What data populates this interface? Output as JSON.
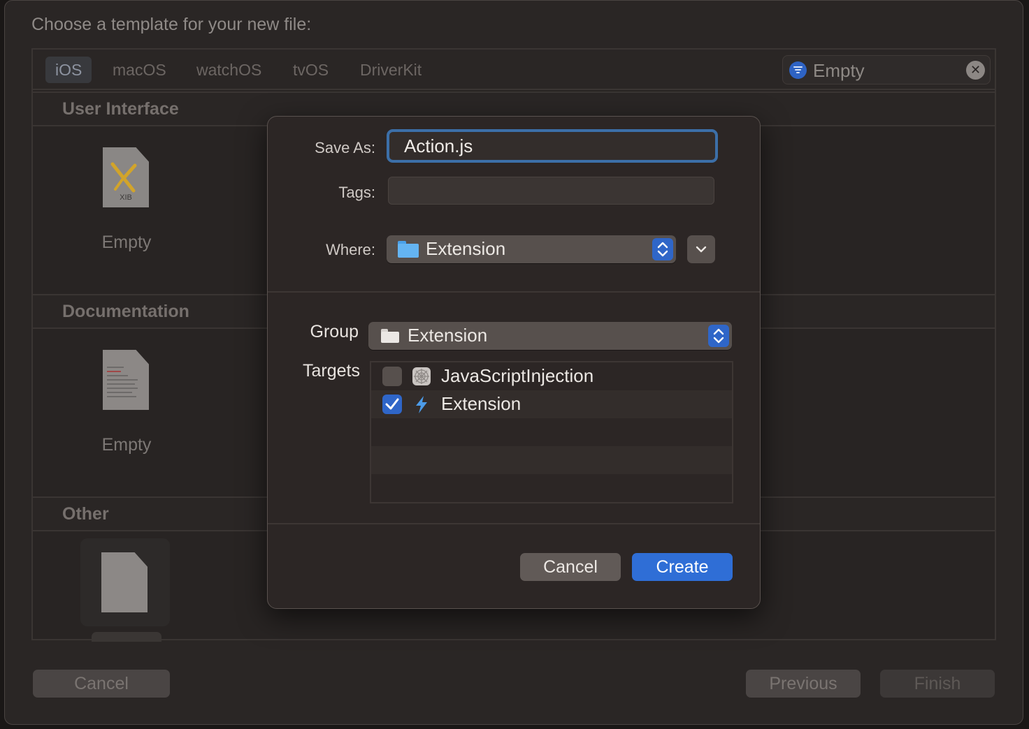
{
  "window": {
    "title": "Choose a template for your new file:"
  },
  "platform_tabs": [
    {
      "label": "iOS",
      "active": true
    },
    {
      "label": "macOS",
      "active": false
    },
    {
      "label": "watchOS",
      "active": false
    },
    {
      "label": "tvOS",
      "active": false
    },
    {
      "label": "DriverKit",
      "active": false
    }
  ],
  "filter": {
    "value": "Empty"
  },
  "sections": [
    {
      "title": "User Interface",
      "item_label": "Empty",
      "icon": "xib-file-icon",
      "icon_text": "XIB"
    },
    {
      "title": "Documentation",
      "item_label": "Empty",
      "icon": "document-file-icon"
    },
    {
      "title": "Other",
      "item_label": "",
      "icon": "blank-file-icon"
    }
  ],
  "bottom_buttons": {
    "cancel": "Cancel",
    "previous": "Previous",
    "finish": "Finish"
  },
  "dialog": {
    "save_as_label": "Save As:",
    "save_as_value": "Action.js",
    "tags_label": "Tags:",
    "tags_value": "",
    "where_label": "Where:",
    "where_value": "Extension",
    "group_label": "Group",
    "group_value": "Extension",
    "targets_label": "Targets",
    "targets": [
      {
        "name": "JavaScriptInjection",
        "checked": false,
        "icon": "app-target-icon"
      },
      {
        "name": "Extension",
        "checked": true,
        "icon": "extension-bolt-icon"
      }
    ],
    "cancel": "Cancel",
    "create": "Create",
    "colors": {
      "accent": "#2f6ed6",
      "focus_ring": "#3c6fa8"
    }
  }
}
